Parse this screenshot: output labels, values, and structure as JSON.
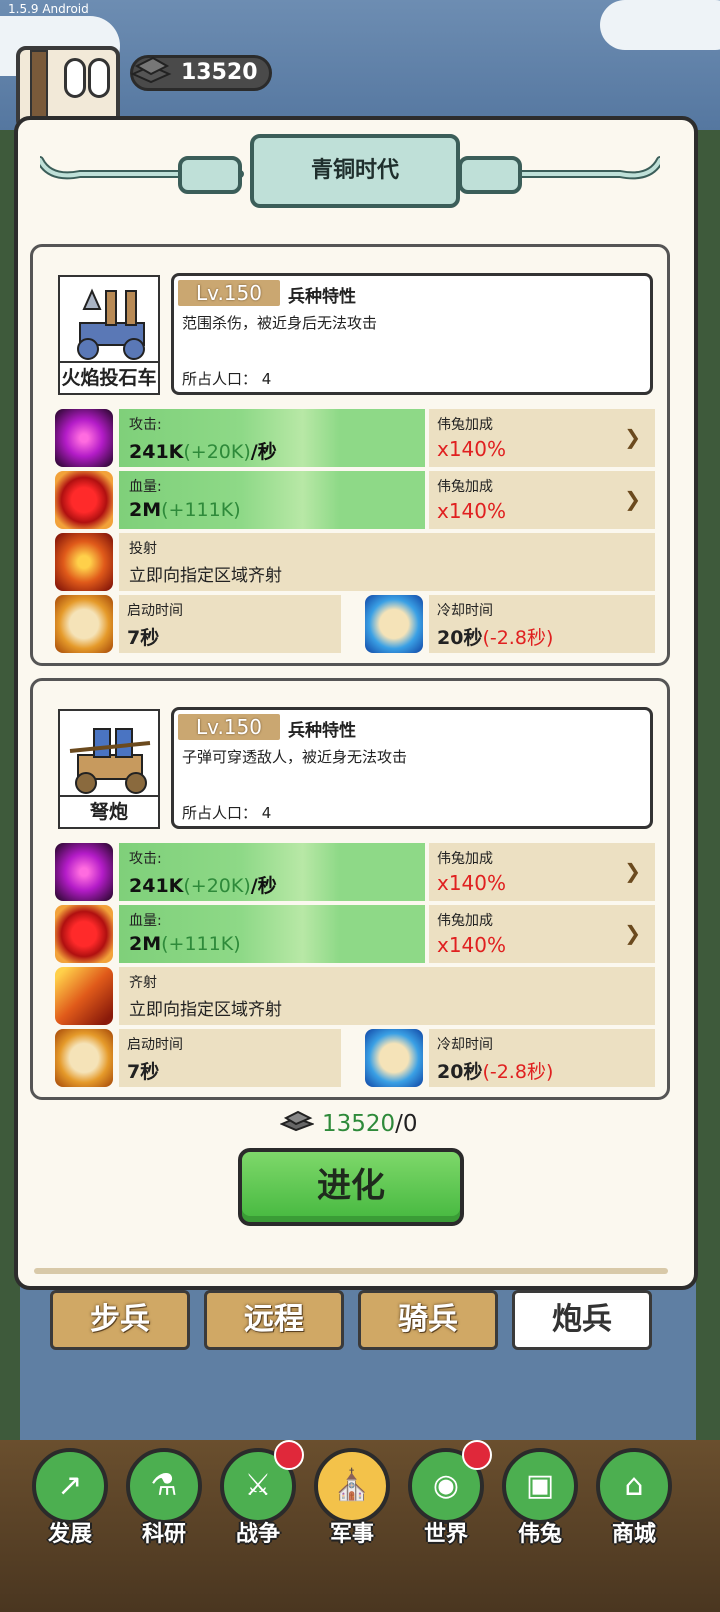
{
  "status_bar": {
    "version": "1.5.9 Android"
  },
  "header": {
    "resource_amount": "13520"
  },
  "panel": {
    "era_title": "青铜时代"
  },
  "units": [
    {
      "name": "火焰投石车",
      "level": "Lv.150",
      "trait_title": "兵种特性",
      "trait_desc": "范围杀伤，被近身后无法攻击",
      "population": "所占人口：  4",
      "attack": {
        "label": "攻击:",
        "base": "241K",
        "bonus": "(+20K)",
        "suffix": "/秒"
      },
      "attack_buff": {
        "label": "伟兔加成",
        "value": "x140%"
      },
      "hp": {
        "label": "血量:",
        "base": "2M",
        "bonus": "(+111K)"
      },
      "hp_buff": {
        "label": "伟兔加成",
        "value": "x140%"
      },
      "skill": {
        "name": "投射",
        "desc": "立即向指定区域齐射"
      },
      "startup": {
        "label": "启动时间",
        "value": "7秒"
      },
      "cooldown": {
        "label": "冷却时间",
        "value": "20秒",
        "bonus": "(-2.8秒)"
      }
    },
    {
      "name": "弩炮",
      "level": "Lv.150",
      "trait_title": "兵种特性",
      "trait_desc": "子弹可穿透敌人，被近身无法攻击",
      "population": "所占人口：  4",
      "attack": {
        "label": "攻击:",
        "base": "241K",
        "bonus": "(+20K)",
        "suffix": "/秒"
      },
      "attack_buff": {
        "label": "伟兔加成",
        "value": "x140%"
      },
      "hp": {
        "label": "血量:",
        "base": "2M",
        "bonus": "(+111K)"
      },
      "hp_buff": {
        "label": "伟兔加成",
        "value": "x140%"
      },
      "skill": {
        "name": "齐射",
        "desc": "立即向指定区域齐射"
      },
      "startup": {
        "label": "启动时间",
        "value": "7秒"
      },
      "cooldown": {
        "label": "冷却时间",
        "value": "20秒",
        "bonus": "(-2.8秒)"
      }
    }
  ],
  "cost": {
    "have": "13520",
    "need": "/0"
  },
  "evolve_button": "进化",
  "tabs": [
    "步兵",
    "远程",
    "骑兵",
    "炮兵"
  ],
  "active_tab": "炮兵",
  "nav": [
    "发展",
    "科研",
    "战争",
    "军事",
    "世界",
    "伟兔",
    "商城"
  ],
  "active_nav": "军事",
  "colors": {
    "bonus_green": "#2e8a3a",
    "buff_red": "#e02020",
    "tab_gold": "#d0a865"
  }
}
